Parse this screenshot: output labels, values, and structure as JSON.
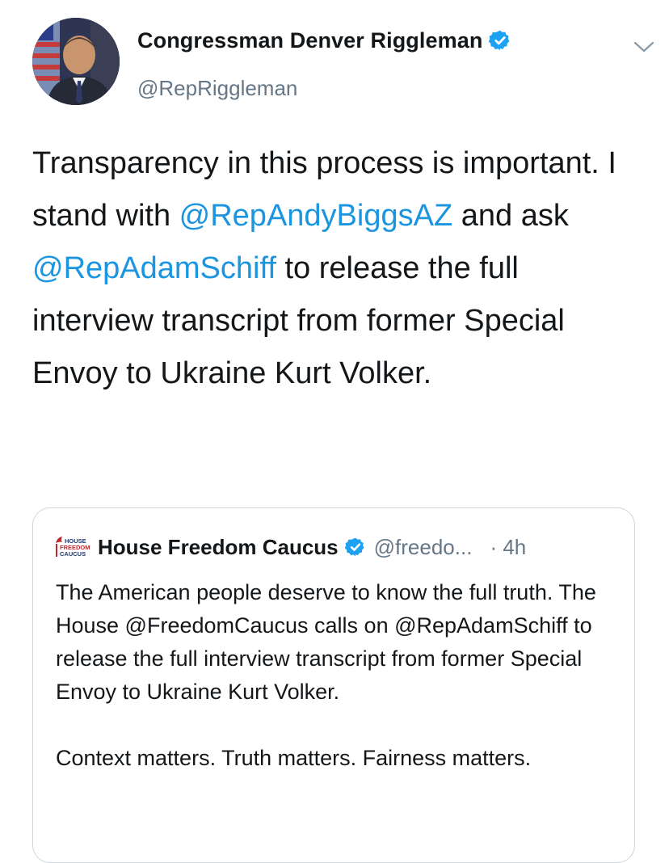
{
  "author": {
    "display_name": "Congressman Denver Riggleman",
    "handle": "@RepRiggleman",
    "verified": true
  },
  "tweet": {
    "text_1": "Transparency in this process is important.  I stand with ",
    "mention_1": "@RepAndyBiggsAZ",
    "text_2": " and ask ",
    "mention_2": "@RepAdamSchiff",
    "text_3": " to release the full interview transcript from former Special Envoy to Ukraine Kurt Volker."
  },
  "quoted_tweet": {
    "logo_text": "HOUSE FREEDOM CAUCUS",
    "display_name": "House Freedom Caucus",
    "handle": "@freedo...",
    "time": "· 4h",
    "paragraph_1": "The American people deserve to know the full truth. The House @FreedomCaucus calls on @RepAdamSchiff to release the full interview transcript from former Special Envoy to Ukraine Kurt Volker.",
    "paragraph_2": "Context matters. Truth matters. Fairness matters."
  },
  "icons": {
    "verified": "verified-badge-icon",
    "more": "chevron-down-icon"
  },
  "colors": {
    "link": "#1b95e0",
    "verified": "#1da1f2",
    "secondary_text": "#657786",
    "border": "#ccd6dd",
    "logo_red": "#c0272d",
    "logo_navy": "#1f3a6e"
  }
}
